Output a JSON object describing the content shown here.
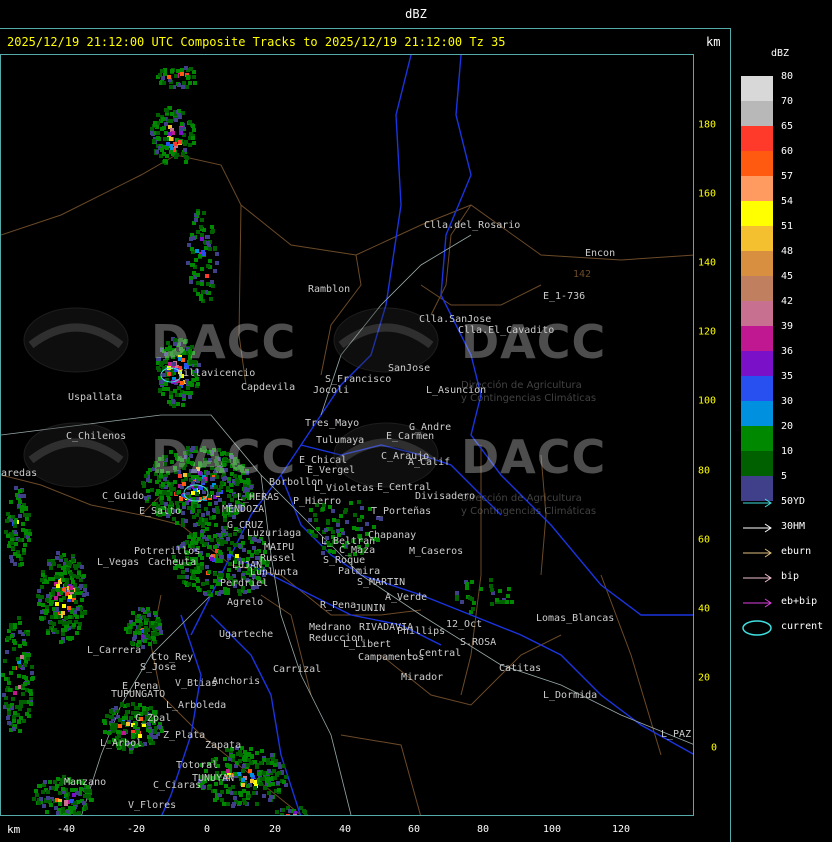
{
  "window": {
    "title": "dBZ",
    "header": "2025/12/19 21:12:00 UTC Composite Tracks to 2025/12/19 21:12:00 Tz 35",
    "km_label": "km"
  },
  "legend": {
    "title": "dBZ",
    "items": [
      {
        "label": "80",
        "color": "#d8d8d8"
      },
      {
        "label": "70",
        "color": "#b8b8b8"
      },
      {
        "label": "65",
        "color": "#ff3a2a"
      },
      {
        "label": "60",
        "color": "#ff5a10"
      },
      {
        "label": "57",
        "color": "#ff9a60"
      },
      {
        "label": "54",
        "color": "#ffff00"
      },
      {
        "label": "51",
        "color": "#f5c030"
      },
      {
        "label": "48",
        "color": "#d89040"
      },
      {
        "label": "45",
        "color": "#c08060"
      },
      {
        "label": "42",
        "color": "#c87090"
      },
      {
        "label": "39",
        "color": "#c01890"
      },
      {
        "label": "36",
        "color": "#7a10c8"
      },
      {
        "label": "35",
        "color": "#2850f0"
      },
      {
        "label": "30",
        "color": "#0090e0"
      },
      {
        "label": "20",
        "color": "#008800"
      },
      {
        "label": "10",
        "color": "#006000"
      },
      {
        "label": "5",
        "color": "#40408a"
      }
    ]
  },
  "tracks": [
    {
      "label": "50YD",
      "color": "#40e0e0"
    },
    {
      "label": "30HM",
      "color": "#ffffff"
    },
    {
      "label": "eburn",
      "color": "#e0c080"
    },
    {
      "label": "bip",
      "color": "#f0c0d0"
    },
    {
      "label": "eb+bip",
      "color": "#e040e0"
    },
    {
      "label": "current",
      "color": "#40e0e0"
    }
  ],
  "axes": {
    "x_unit": "km",
    "x_ticks": [
      "-40",
      "-20",
      "0",
      "20",
      "40",
      "60",
      "80",
      "100",
      "120"
    ],
    "y_ticks": [
      "180",
      "160",
      "140",
      "120",
      "100",
      "80",
      "60",
      "40",
      "20",
      "0"
    ]
  },
  "watermark": {
    "name": "DACC",
    "line1": "Dirección de Agricultura",
    "line2": "y Contingencias Climáticas"
  },
  "places": [
    {
      "name": "Clla.del_Rosario"
    },
    {
      "name": "Encon"
    },
    {
      "name": "142"
    },
    {
      "name": "E_1-736"
    },
    {
      "name": "Ramblon"
    },
    {
      "name": "Clla.SanJose"
    },
    {
      "name": "Clla.El_Cavadito"
    },
    {
      "name": "Uspallata"
    },
    {
      "name": "Villavicencio"
    },
    {
      "name": "Capdevila"
    },
    {
      "name": "S_Francisco"
    },
    {
      "name": "Jocoli"
    },
    {
      "name": "SanJose"
    },
    {
      "name": "L_Asuncion"
    },
    {
      "name": "Tres_Mayo"
    },
    {
      "name": "Tulumaya"
    },
    {
      "name": "G_Andre"
    },
    {
      "name": "E_Carmen"
    },
    {
      "name": "C_Chilenos"
    },
    {
      "name": "E_Chical"
    },
    {
      "name": "E_Vergel"
    },
    {
      "name": "C_Araujo"
    },
    {
      "name": "A_Calif"
    },
    {
      "name": "aredas"
    },
    {
      "name": "Borbollon"
    },
    {
      "name": "L_Violetas"
    },
    {
      "name": "E_Central"
    },
    {
      "name": "Divisadero"
    },
    {
      "name": "C_Guido"
    },
    {
      "name": "L_HERAS"
    },
    {
      "name": "P_Hierro"
    },
    {
      "name": "MENDOZA"
    },
    {
      "name": "T_Porteñas"
    },
    {
      "name": "E_Salto"
    },
    {
      "name": "G_CRUZ"
    },
    {
      "name": "Chapanay"
    },
    {
      "name": "Luzuriaga"
    },
    {
      "name": "L_Beltran"
    },
    {
      "name": "MAIPU"
    },
    {
      "name": "Potrerillos"
    },
    {
      "name": "Russel"
    },
    {
      "name": "C_Maza"
    },
    {
      "name": "M_Caseros"
    },
    {
      "name": "L_Vegas"
    },
    {
      "name": "Cacheuta"
    },
    {
      "name": "S_Roque"
    },
    {
      "name": "LUJAN"
    },
    {
      "name": "Palmira"
    },
    {
      "name": "Lunlunta"
    },
    {
      "name": "S_MARTIN"
    },
    {
      "name": "Perdriel"
    },
    {
      "name": "A_Verde"
    },
    {
      "name": "Agrelo"
    },
    {
      "name": "Ramblon"
    },
    {
      "name": "R_Pena"
    },
    {
      "name": "JUNIN"
    },
    {
      "name": "Ugarteche"
    },
    {
      "name": "Medrano"
    },
    {
      "name": "RIVADAVIA"
    },
    {
      "name": "12_Oct"
    },
    {
      "name": "Phillips"
    },
    {
      "name": "Lomas_Blancas"
    },
    {
      "name": "Reduccion"
    },
    {
      "name": "L_Libert"
    },
    {
      "name": "S.ROSA"
    },
    {
      "name": "L_Carrera"
    },
    {
      "name": "Cto_Rey"
    },
    {
      "name": "Campamentos"
    },
    {
      "name": "L_Central"
    },
    {
      "name": "Catitas"
    },
    {
      "name": "S_Jose"
    },
    {
      "name": "Carrizal"
    },
    {
      "name": "Anchoris"
    },
    {
      "name": "V_Btias"
    },
    {
      "name": "Mirador"
    },
    {
      "name": "E_Pena"
    },
    {
      "name": "TUPUNGATO"
    },
    {
      "name": "L_Dormida"
    },
    {
      "name": "L_Arboleda"
    },
    {
      "name": "C_Zpal"
    },
    {
      "name": "Z_Plata"
    },
    {
      "name": "L_Arbol"
    },
    {
      "name": "Zapata"
    },
    {
      "name": "L_PAZ"
    },
    {
      "name": "Totoral"
    },
    {
      "name": "TUNUYAN"
    },
    {
      "name": "Manzano"
    },
    {
      "name": "C_Ciaras"
    },
    {
      "name": "V_Flores"
    }
  ]
}
